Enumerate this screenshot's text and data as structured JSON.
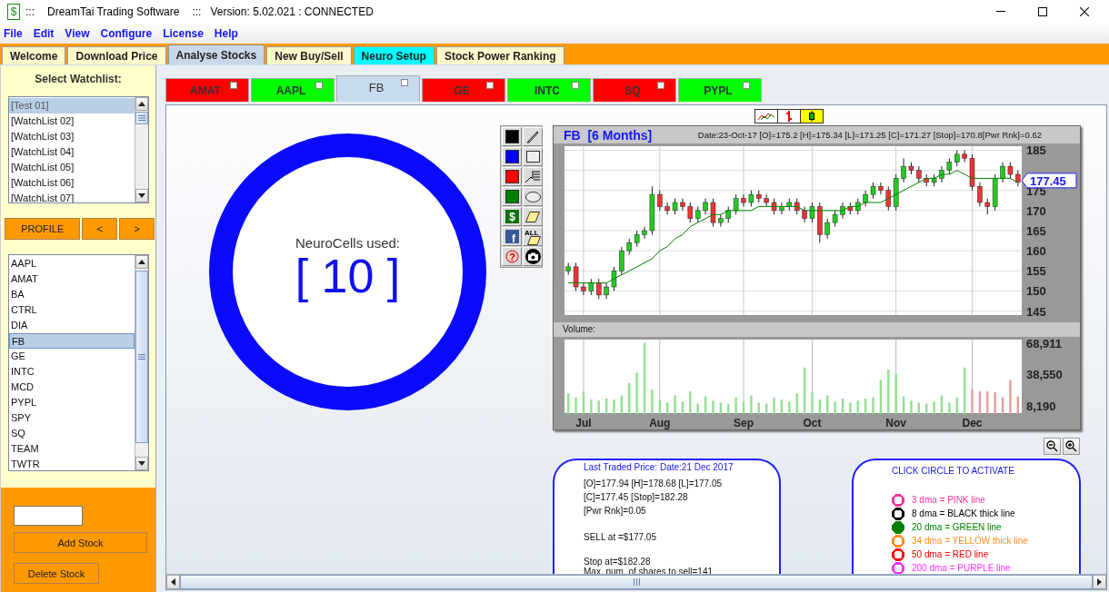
{
  "window": {
    "app_icon": "$",
    "separator_1": ":::",
    "title": "DreamTai Trading Software",
    "separator_2": ":::",
    "status": "Version: 5.02.021  : CONNECTED"
  },
  "menu": [
    "File",
    "Edit",
    "View",
    "Configure",
    "License",
    "Help"
  ],
  "main_tabs": [
    {
      "label": "Welcome",
      "selected": false,
      "color": "#fffacd"
    },
    {
      "label": "Download Price",
      "selected": false,
      "color": "#fffacd"
    },
    {
      "label": "Analyse Stocks",
      "selected": true,
      "color": "#c8d8ea"
    },
    {
      "label": "New Buy/Sell",
      "selected": false,
      "color": "#fffacd"
    },
    {
      "label": "Neuro Setup",
      "selected": false,
      "color": "#00ffff"
    },
    {
      "label": "Stock Power Ranking",
      "selected": false,
      "color": "#fffacd"
    }
  ],
  "watchlist_panel": {
    "heading": "Select Watchlist:",
    "watchlists": [
      {
        "label": "[Test 01]",
        "selected": true
      },
      {
        "label": "[WatchList 02]",
        "selected": false
      },
      {
        "label": "[WatchList 03]",
        "selected": false
      },
      {
        "label": "[WatchList 04]",
        "selected": false
      },
      {
        "label": "[WatchList 05]",
        "selected": false
      },
      {
        "label": "[WatchList 06]",
        "selected": false
      },
      {
        "label": "[WatchList 07]",
        "selected": false
      }
    ],
    "profile_button": "PROFILE",
    "prev_button": "<",
    "next_button": ">",
    "symbols": [
      {
        "label": "AAPL",
        "selected": false
      },
      {
        "label": "AMAT",
        "selected": false
      },
      {
        "label": "BA",
        "selected": false
      },
      {
        "label": "CTRL",
        "selected": false
      },
      {
        "label": "DIA",
        "selected": false
      },
      {
        "label": "FB",
        "selected": true
      },
      {
        "label": "GE",
        "selected": false
      },
      {
        "label": "INTC",
        "selected": false
      },
      {
        "label": "MCD",
        "selected": false
      },
      {
        "label": "PYPL",
        "selected": false
      },
      {
        "label": "SPY",
        "selected": false
      },
      {
        "label": "SQ",
        "selected": false
      },
      {
        "label": "TEAM",
        "selected": false
      },
      {
        "label": "TWTR",
        "selected": false
      }
    ],
    "add_button": "Add Stock",
    "delete_button": "Delete Stock"
  },
  "stock_tabs": [
    {
      "label": "AMAT",
      "selected": false,
      "color": "#ff0000"
    },
    {
      "label": "AAPL",
      "selected": false,
      "color": "#00ff00"
    },
    {
      "label": "FB",
      "selected": true,
      "color": "#c8daee"
    },
    {
      "label": "GE",
      "selected": false,
      "color": "#ff0000"
    },
    {
      "label": "INTC",
      "selected": false,
      "color": "#00ff00"
    },
    {
      "label": "SQ",
      "selected": false,
      "color": "#ff0000"
    },
    {
      "label": "PYPL",
      "selected": false,
      "color": "#00ff00"
    }
  ],
  "neuro": {
    "label": "NeuroCells used:",
    "value": "[ 10 ]"
  },
  "tools": [
    {
      "kind": "swatch",
      "color": "#000000"
    },
    {
      "kind": "pen"
    },
    {
      "kind": "swatch",
      "color": "#0000ff"
    },
    {
      "kind": "rect"
    },
    {
      "kind": "swatch",
      "color": "#ff0000"
    },
    {
      "kind": "lines"
    },
    {
      "kind": "swatch",
      "color": "#008000"
    },
    {
      "kind": "ellipse"
    },
    {
      "kind": "dollar",
      "glyph": "$"
    },
    {
      "kind": "eraser"
    },
    {
      "kind": "facebook",
      "glyph": "f"
    },
    {
      "kind": "eraser_all",
      "glyph": "ALL"
    },
    {
      "kind": "help",
      "glyph": "?"
    },
    {
      "kind": "camera"
    }
  ],
  "chart_types": [
    {
      "kind": "line",
      "selected": false
    },
    {
      "kind": "bar",
      "selected": false
    },
    {
      "kind": "candle",
      "selected": true
    }
  ],
  "chart": {
    "title": "FB  [6 Months]",
    "info": "Date:23-Oct-17 [O]=175.2 [H]=175.34 [L]=171.25 [C]=171.27 [Stop]=170.8[Pwr Rnk]=0.62",
    "current_price": "177.45",
    "chart_data": {
      "type": "candlestick",
      "grid": true,
      "ylim": [
        144,
        186
      ],
      "yticks": [
        145,
        150,
        155,
        160,
        165,
        170,
        175,
        185
      ],
      "categories": [
        null,
        null,
        null,
        null,
        null,
        null,
        null,
        null,
        null,
        null,
        null,
        null,
        null,
        null,
        null,
        null,
        null,
        null,
        null,
        null,
        null,
        null,
        null,
        null,
        null,
        null,
        null,
        null,
        null,
        null,
        null,
        null,
        null,
        null,
        null,
        null,
        null,
        null,
        null,
        null,
        null,
        null,
        null,
        null,
        null,
        null,
        null,
        null,
        null,
        null,
        null,
        null,
        null,
        null,
        null,
        null,
        null,
        null,
        null,
        null
      ],
      "ohlc": [
        [
          155,
          157,
          154,
          156
        ],
        [
          156,
          157,
          150,
          151
        ],
        [
          151,
          152,
          149,
          150
        ],
        [
          150,
          153,
          149,
          152
        ],
        [
          152,
          153,
          148,
          149
        ],
        [
          149,
          152,
          148,
          151
        ],
        [
          151,
          156,
          150,
          155
        ],
        [
          155,
          161,
          154,
          160
        ],
        [
          160,
          163,
          159,
          162
        ],
        [
          162,
          165,
          161,
          164
        ],
        [
          164,
          166,
          163,
          165
        ],
        [
          165,
          176,
          164,
          174
        ],
        [
          174,
          175,
          170,
          171
        ],
        [
          171,
          172,
          169,
          170
        ],
        [
          170,
          173,
          169,
          172
        ],
        [
          172,
          173,
          170,
          171
        ],
        [
          171,
          172,
          167,
          168
        ],
        [
          168,
          171,
          167,
          170
        ],
        [
          170,
          173,
          169,
          172
        ],
        [
          172,
          173,
          166,
          167
        ],
        [
          167,
          169,
          166,
          168
        ],
        [
          168,
          171,
          167,
          170
        ],
        [
          170,
          174,
          169,
          173
        ],
        [
          173,
          174,
          171,
          172
        ],
        [
          172,
          175,
          171,
          174
        ],
        [
          174,
          175,
          172,
          173
        ],
        [
          173,
          174,
          171,
          172
        ],
        [
          172,
          173,
          169,
          170
        ],
        [
          170,
          172,
          169,
          171
        ],
        [
          171,
          173,
          170,
          172
        ],
        [
          172,
          173,
          169,
          170
        ],
        [
          170,
          171,
          167,
          168
        ],
        [
          168,
          172,
          167,
          171
        ],
        [
          171,
          172,
          162,
          164
        ],
        [
          164,
          168,
          163,
          167
        ],
        [
          167,
          170,
          166,
          169
        ],
        [
          169,
          172,
          168,
          171
        ],
        [
          171,
          172,
          169,
          170
        ],
        [
          170,
          173,
          169,
          172
        ],
        [
          172,
          175,
          171,
          174
        ],
        [
          174,
          177,
          173,
          176
        ],
        [
          176,
          177,
          174,
          175
        ],
        [
          175,
          176,
          170,
          171
        ],
        [
          171,
          179,
          170,
          178
        ],
        [
          178,
          183,
          177,
          181
        ],
        [
          181,
          182,
          179,
          180
        ],
        [
          180,
          181,
          177,
          178
        ],
        [
          178,
          179,
          176,
          177
        ],
        [
          177,
          179,
          176,
          178
        ],
        [
          178,
          181,
          177,
          180
        ],
        [
          180,
          183,
          179,
          182
        ],
        [
          182,
          185,
          181,
          184
        ],
        [
          184,
          185,
          182,
          183
        ],
        [
          183,
          184,
          175,
          176
        ],
        [
          176,
          177,
          171,
          172
        ],
        [
          172,
          173,
          169,
          171
        ],
        [
          171,
          179,
          170,
          178
        ],
        [
          178,
          182,
          177,
          181
        ],
        [
          181,
          182,
          178,
          179
        ],
        [
          179,
          180,
          176,
          177
        ]
      ],
      "series": [
        {
          "type": "line",
          "color": "#008000",
          "values": [
            152,
            152,
            152,
            152,
            152,
            152,
            153,
            154,
            155,
            156,
            157,
            158,
            160,
            161,
            163,
            164,
            166,
            167,
            168,
            169,
            169,
            170,
            170,
            170,
            170,
            171,
            171,
            171,
            171,
            171,
            171,
            170,
            170,
            170,
            170,
            170,
            170,
            171,
            171,
            172,
            172,
            172,
            173,
            174,
            175,
            176,
            177,
            178,
            178,
            179,
            179,
            180,
            179,
            178,
            178,
            178,
            178,
            178,
            178,
            177
          ]
        }
      ]
    }
  },
  "volume": {
    "label": "Volume:",
    "chart_data": {
      "type": "bar",
      "grid": true,
      "ylim": [
        0,
        72000
      ],
      "yticks": [
        {
          "value": 8190,
          "label": "8,190"
        },
        {
          "value": 38550,
          "label": "38,550"
        },
        {
          "value": 68911,
          "label": "68,911"
        }
      ],
      "categories": [
        null,
        null,
        "Jul",
        null,
        null,
        null,
        null,
        null,
        null,
        null,
        null,
        null,
        "Aug",
        null,
        null,
        null,
        null,
        null,
        null,
        null,
        null,
        null,
        null,
        "Sep",
        null,
        null,
        null,
        null,
        null,
        null,
        null,
        null,
        "Oct",
        null,
        null,
        null,
        null,
        null,
        null,
        null,
        null,
        null,
        null,
        "Nov",
        null,
        null,
        null,
        null,
        null,
        null,
        null,
        null,
        null,
        "Dec",
        null,
        null,
        null,
        null,
        null,
        null
      ],
      "series": [
        {
          "color": "#90e090",
          "values": [
            20000,
            16000,
            22000,
            14000,
            13000,
            15000,
            14000,
            18000,
            30000,
            40000,
            68911,
            24000,
            14000,
            11000,
            18000,
            12000,
            22000,
            10000,
            17000,
            13000,
            11000,
            10000,
            16000,
            12000,
            18000,
            11000,
            10000,
            16000,
            14000,
            12000,
            20000,
            45000,
            21000,
            14000,
            18000,
            12000,
            15000,
            11000,
            13000,
            15000,
            16000,
            33000,
            43000,
            39000,
            17000,
            13000,
            11000,
            10000,
            12000,
            18000,
            11000,
            16000,
            45000,
            null,
            null,
            null,
            null,
            null,
            null,
            null
          ]
        },
        {
          "color": "#e89a9a",
          "values": [
            null,
            null,
            null,
            null,
            null,
            null,
            null,
            null,
            null,
            null,
            null,
            null,
            null,
            null,
            null,
            null,
            null,
            null,
            null,
            null,
            null,
            null,
            null,
            null,
            null,
            null,
            null,
            null,
            null,
            null,
            null,
            null,
            null,
            null,
            null,
            null,
            null,
            null,
            null,
            null,
            null,
            null,
            null,
            null,
            null,
            null,
            null,
            null,
            null,
            null,
            null,
            null,
            null,
            24000,
            22000,
            22000,
            21000,
            16000,
            33000,
            17000
          ]
        }
      ]
    }
  },
  "last_trade": {
    "heading": "Last Traded Price: Date:21 Dec 2017",
    "groups": [
      [
        "[O]=177.94 [H]=178.68 [L]=177.05",
        "[C]=177.45 [Stop]=182.28",
        "[Pwr Rnk]=0.05"
      ],
      [
        "SELL at =$177.05"
      ],
      [
        "Stop at=$182.28",
        "Max. num. of shares to sell=141"
      ]
    ]
  },
  "dma": {
    "heading": "CLICK CIRCLE TO ACTIVATE",
    "lines": [
      {
        "label": "3 dma = PINK line",
        "color": "#ff3399",
        "on": false
      },
      {
        "label": "8 dma = BLACK thick line",
        "color": "#000000",
        "on": false
      },
      {
        "label": "20 dma = GREEN line",
        "color": "#008000",
        "on": true
      },
      {
        "label": "34 dma = YELLOW thick line",
        "color": "#ff8c1a",
        "on": false
      },
      {
        "label": "50 dma = RED line",
        "color": "#ff0000",
        "on": false
      },
      {
        "label": "200 dma = PURPLE line",
        "color": "#ff33ff",
        "on": false
      }
    ]
  }
}
